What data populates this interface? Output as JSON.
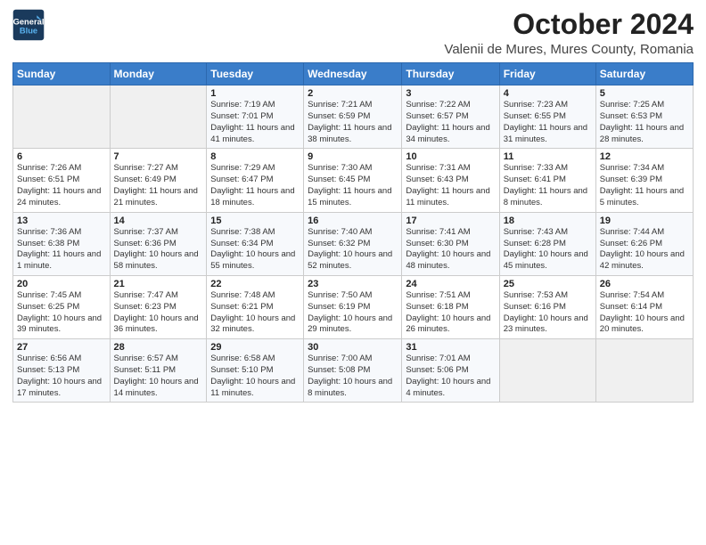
{
  "logo": {
    "line1": "General",
    "line2": "Blue"
  },
  "title": "October 2024",
  "location": "Valenii de Mures, Mures County, Romania",
  "weekdays": [
    "Sunday",
    "Monday",
    "Tuesday",
    "Wednesday",
    "Thursday",
    "Friday",
    "Saturday"
  ],
  "weeks": [
    [
      {
        "day": "",
        "info": ""
      },
      {
        "day": "",
        "info": ""
      },
      {
        "day": "1",
        "info": "Sunrise: 7:19 AM\nSunset: 7:01 PM\nDaylight: 11 hours and 41 minutes."
      },
      {
        "day": "2",
        "info": "Sunrise: 7:21 AM\nSunset: 6:59 PM\nDaylight: 11 hours and 38 minutes."
      },
      {
        "day": "3",
        "info": "Sunrise: 7:22 AM\nSunset: 6:57 PM\nDaylight: 11 hours and 34 minutes."
      },
      {
        "day": "4",
        "info": "Sunrise: 7:23 AM\nSunset: 6:55 PM\nDaylight: 11 hours and 31 minutes."
      },
      {
        "day": "5",
        "info": "Sunrise: 7:25 AM\nSunset: 6:53 PM\nDaylight: 11 hours and 28 minutes."
      }
    ],
    [
      {
        "day": "6",
        "info": "Sunrise: 7:26 AM\nSunset: 6:51 PM\nDaylight: 11 hours and 24 minutes."
      },
      {
        "day": "7",
        "info": "Sunrise: 7:27 AM\nSunset: 6:49 PM\nDaylight: 11 hours and 21 minutes."
      },
      {
        "day": "8",
        "info": "Sunrise: 7:29 AM\nSunset: 6:47 PM\nDaylight: 11 hours and 18 minutes."
      },
      {
        "day": "9",
        "info": "Sunrise: 7:30 AM\nSunset: 6:45 PM\nDaylight: 11 hours and 15 minutes."
      },
      {
        "day": "10",
        "info": "Sunrise: 7:31 AM\nSunset: 6:43 PM\nDaylight: 11 hours and 11 minutes."
      },
      {
        "day": "11",
        "info": "Sunrise: 7:33 AM\nSunset: 6:41 PM\nDaylight: 11 hours and 8 minutes."
      },
      {
        "day": "12",
        "info": "Sunrise: 7:34 AM\nSunset: 6:39 PM\nDaylight: 11 hours and 5 minutes."
      }
    ],
    [
      {
        "day": "13",
        "info": "Sunrise: 7:36 AM\nSunset: 6:38 PM\nDaylight: 11 hours and 1 minute."
      },
      {
        "day": "14",
        "info": "Sunrise: 7:37 AM\nSunset: 6:36 PM\nDaylight: 10 hours and 58 minutes."
      },
      {
        "day": "15",
        "info": "Sunrise: 7:38 AM\nSunset: 6:34 PM\nDaylight: 10 hours and 55 minutes."
      },
      {
        "day": "16",
        "info": "Sunrise: 7:40 AM\nSunset: 6:32 PM\nDaylight: 10 hours and 52 minutes."
      },
      {
        "day": "17",
        "info": "Sunrise: 7:41 AM\nSunset: 6:30 PM\nDaylight: 10 hours and 48 minutes."
      },
      {
        "day": "18",
        "info": "Sunrise: 7:43 AM\nSunset: 6:28 PM\nDaylight: 10 hours and 45 minutes."
      },
      {
        "day": "19",
        "info": "Sunrise: 7:44 AM\nSunset: 6:26 PM\nDaylight: 10 hours and 42 minutes."
      }
    ],
    [
      {
        "day": "20",
        "info": "Sunrise: 7:45 AM\nSunset: 6:25 PM\nDaylight: 10 hours and 39 minutes."
      },
      {
        "day": "21",
        "info": "Sunrise: 7:47 AM\nSunset: 6:23 PM\nDaylight: 10 hours and 36 minutes."
      },
      {
        "day": "22",
        "info": "Sunrise: 7:48 AM\nSunset: 6:21 PM\nDaylight: 10 hours and 32 minutes."
      },
      {
        "day": "23",
        "info": "Sunrise: 7:50 AM\nSunset: 6:19 PM\nDaylight: 10 hours and 29 minutes."
      },
      {
        "day": "24",
        "info": "Sunrise: 7:51 AM\nSunset: 6:18 PM\nDaylight: 10 hours and 26 minutes."
      },
      {
        "day": "25",
        "info": "Sunrise: 7:53 AM\nSunset: 6:16 PM\nDaylight: 10 hours and 23 minutes."
      },
      {
        "day": "26",
        "info": "Sunrise: 7:54 AM\nSunset: 6:14 PM\nDaylight: 10 hours and 20 minutes."
      }
    ],
    [
      {
        "day": "27",
        "info": "Sunrise: 6:56 AM\nSunset: 5:13 PM\nDaylight: 10 hours and 17 minutes."
      },
      {
        "day": "28",
        "info": "Sunrise: 6:57 AM\nSunset: 5:11 PM\nDaylight: 10 hours and 14 minutes."
      },
      {
        "day": "29",
        "info": "Sunrise: 6:58 AM\nSunset: 5:10 PM\nDaylight: 10 hours and 11 minutes."
      },
      {
        "day": "30",
        "info": "Sunrise: 7:00 AM\nSunset: 5:08 PM\nDaylight: 10 hours and 8 minutes."
      },
      {
        "day": "31",
        "info": "Sunrise: 7:01 AM\nSunset: 5:06 PM\nDaylight: 10 hours and 4 minutes."
      },
      {
        "day": "",
        "info": ""
      },
      {
        "day": "",
        "info": ""
      }
    ]
  ]
}
